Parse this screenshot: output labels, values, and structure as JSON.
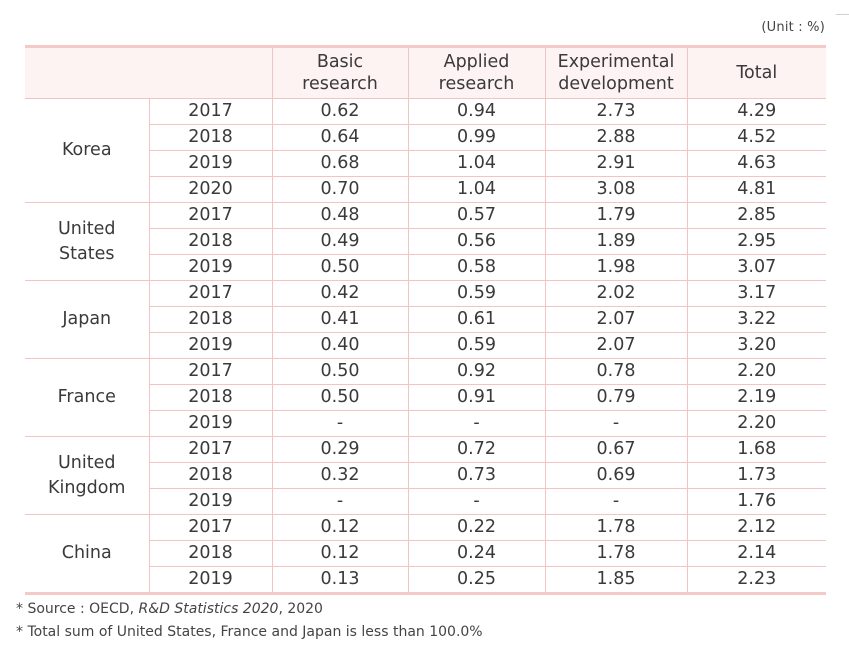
{
  "unit_label": "(Unit : %)",
  "table": {
    "headers": {
      "blank": "",
      "basic": [
        "Basic",
        "research"
      ],
      "applied": [
        "Applied",
        "research"
      ],
      "experimental": [
        "Experimental",
        "development"
      ],
      "total": "Total"
    },
    "groups": [
      {
        "country": [
          "Korea"
        ],
        "rows": [
          {
            "year": "2017",
            "basic": "0.62",
            "applied": "0.94",
            "experimental": "2.73",
            "total": "4.29"
          },
          {
            "year": "2018",
            "basic": "0.64",
            "applied": "0.99",
            "experimental": "2.88",
            "total": "4.52"
          },
          {
            "year": "2019",
            "basic": "0.68",
            "applied": "1.04",
            "experimental": "2.91",
            "total": "4.63"
          },
          {
            "year": "2020",
            "basic": "0.70",
            "applied": "1.04",
            "experimental": "3.08",
            "total": "4.81"
          }
        ]
      },
      {
        "country": [
          "United",
          "States"
        ],
        "rows": [
          {
            "year": "2017",
            "basic": "0.48",
            "applied": "0.57",
            "experimental": "1.79",
            "total": "2.85"
          },
          {
            "year": "2018",
            "basic": "0.49",
            "applied": "0.56",
            "experimental": "1.89",
            "total": "2.95"
          },
          {
            "year": "2019",
            "basic": "0.50",
            "applied": "0.58",
            "experimental": "1.98",
            "total": "3.07"
          }
        ]
      },
      {
        "country": [
          "Japan"
        ],
        "rows": [
          {
            "year": "2017",
            "basic": "0.42",
            "applied": "0.59",
            "experimental": "2.02",
            "total": "3.17"
          },
          {
            "year": "2018",
            "basic": "0.41",
            "applied": "0.61",
            "experimental": "2.07",
            "total": "3.22"
          },
          {
            "year": "2019",
            "basic": "0.40",
            "applied": "0.59",
            "experimental": "2.07",
            "total": "3.20"
          }
        ]
      },
      {
        "country": [
          "France"
        ],
        "rows": [
          {
            "year": "2017",
            "basic": "0.50",
            "applied": "0.92",
            "experimental": "0.78",
            "total": "2.20"
          },
          {
            "year": "2018",
            "basic": "0.50",
            "applied": "0.91",
            "experimental": "0.79",
            "total": "2.19"
          },
          {
            "year": "2019",
            "basic": "-",
            "applied": "-",
            "experimental": "-",
            "total": "2.20"
          }
        ]
      },
      {
        "country": [
          "United",
          "Kingdom"
        ],
        "rows": [
          {
            "year": "2017",
            "basic": "0.29",
            "applied": "0.72",
            "experimental": "0.67",
            "total": "1.68"
          },
          {
            "year": "2018",
            "basic": "0.32",
            "applied": "0.73",
            "experimental": "0.69",
            "total": "1.73"
          },
          {
            "year": "2019",
            "basic": "-",
            "applied": "-",
            "experimental": "-",
            "total": "1.76"
          }
        ]
      },
      {
        "country": [
          "China"
        ],
        "rows": [
          {
            "year": "2017",
            "basic": "0.12",
            "applied": "0.22",
            "experimental": "1.78",
            "total": "2.12"
          },
          {
            "year": "2018",
            "basic": "0.12",
            "applied": "0.24",
            "experimental": "1.78",
            "total": "2.14"
          },
          {
            "year": "2019",
            "basic": "0.13",
            "applied": "0.25",
            "experimental": "1.85",
            "total": "2.23"
          }
        ]
      }
    ]
  },
  "notes": {
    "source_prefix": "* Source : OECD, ",
    "source_title": "R&D Statistics 2020",
    "source_suffix": ", 2020",
    "note2": "* Total sum of United States, France and Japan is less than 100.0%"
  },
  "colors": {
    "border": "#f2c4c4",
    "thick_border": "#f6c9c9",
    "header_bg": "#fdf3f2",
    "text": "#3a3a3a"
  }
}
